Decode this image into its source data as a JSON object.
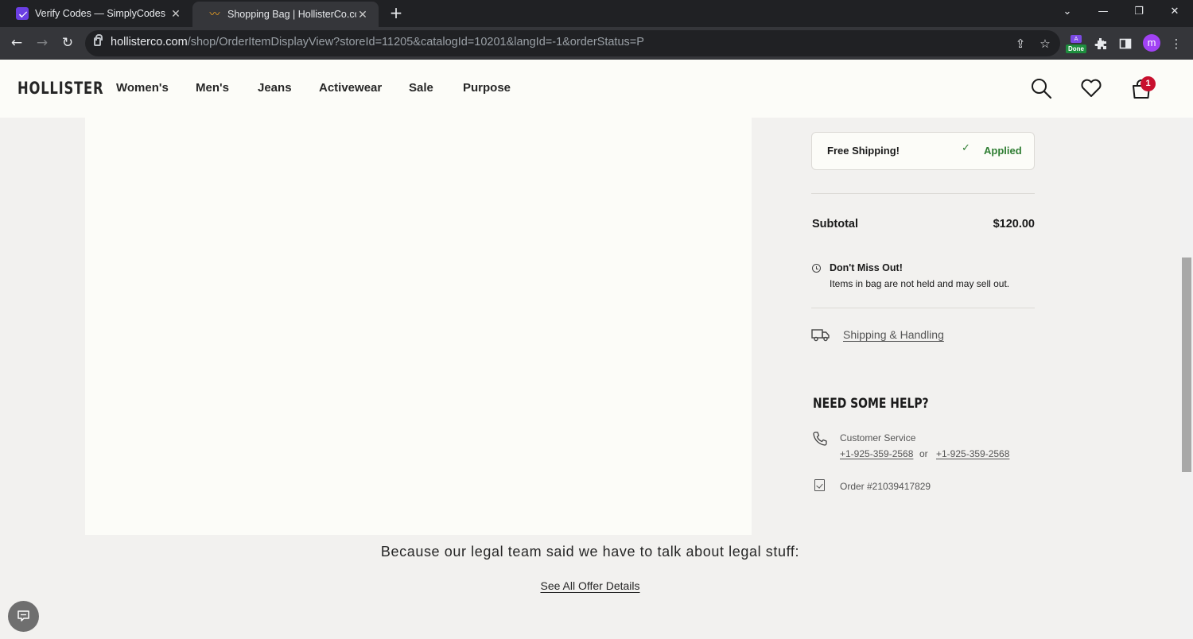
{
  "browser": {
    "tabs": [
      {
        "title": "Verify Codes — SimplyCodes",
        "active": false
      },
      {
        "title": "Shopping Bag | HollisterCo.com",
        "active": true
      }
    ],
    "url_host": "hollisterco.com",
    "url_path": "/shop/OrderItemDisplayView?storeId=11205&catalogId=10201&langId=-1&orderStatus=P",
    "extension_badge": "Done",
    "profile_initial": "m"
  },
  "header": {
    "logo": "HOLLISTER",
    "nav": [
      "Women's",
      "Men's",
      "Jeans",
      "Activewear",
      "Sale",
      "Purpose"
    ],
    "bag_count": "1"
  },
  "summary": {
    "promo_label": "Free Shipping!",
    "promo_status": "Applied",
    "subtotal_label": "Subtotal",
    "subtotal_value": "$120.00",
    "dont_miss_title": "Don't Miss Out!",
    "dont_miss_text": "Items in bag are not held and may sell out.",
    "shipping_link": "Shipping & Handling"
  },
  "help": {
    "title": "NEED SOME HELP?",
    "customer_service_label": "Customer Service",
    "phone_1": "+1-925-359-2568",
    "or": "or",
    "phone_2": "+1-925-359-2568",
    "order_text": "Order #21039417829"
  },
  "legal": {
    "title": "Because our legal team said we have to talk about legal stuff:",
    "offer_link": "See All Offer Details"
  },
  "colors": {
    "accent_green": "#2e7d32",
    "badge_red": "#c8102e"
  }
}
